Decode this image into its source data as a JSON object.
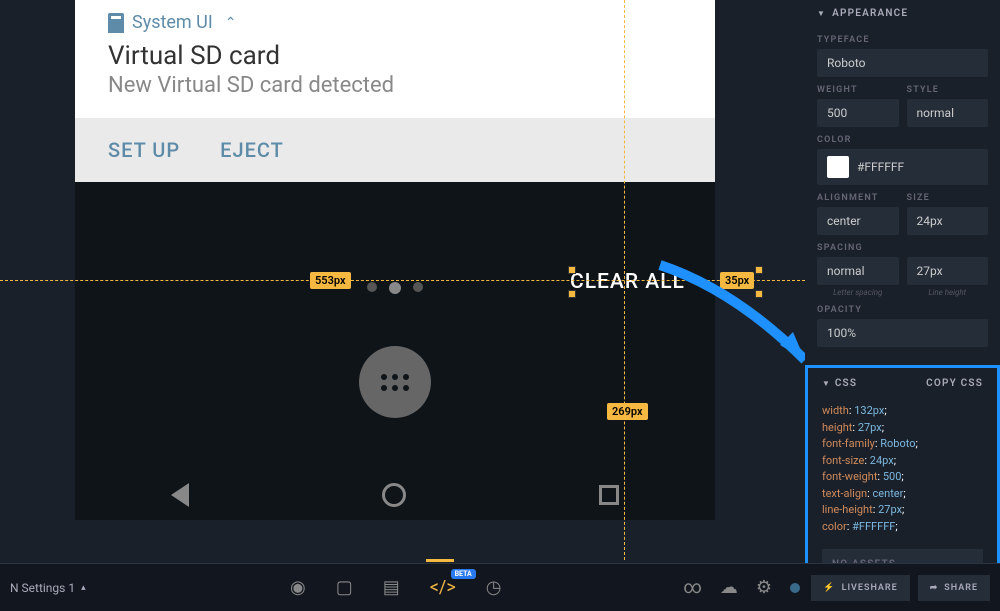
{
  "notification": {
    "app_name": "System UI",
    "title": "Virtual SD card",
    "subtitle": "New Virtual SD card detected",
    "action_setup": "SET UP",
    "action_eject": "EJECT"
  },
  "selected_element": {
    "text": "CLEAR ALL"
  },
  "measurements": {
    "left_distance": "553px",
    "right_distance": "35px",
    "bottom_distance": "269px"
  },
  "appearance": {
    "panel_title": "APPEARANCE",
    "typeface_label": "TYPEFACE",
    "typeface_value": "Roboto",
    "weight_label": "WEIGHT",
    "weight_value": "500",
    "style_label": "STYLE",
    "style_value": "normal",
    "color_label": "COLOR",
    "color_value": "#FFFFFF",
    "alignment_label": "ALIGNMENT",
    "alignment_value": "center",
    "size_label": "SIZE",
    "size_value": "24px",
    "spacing_label": "SPACING",
    "spacing_value": "normal",
    "spacing_sub": "Letter spacing",
    "lineheight_value": "27px",
    "lineheight_sub": "Line height",
    "opacity_label": "OPACITY",
    "opacity_value": "100%"
  },
  "css_panel": {
    "title": "CSS",
    "copy_label": "COPY CSS",
    "lines": [
      {
        "prop": "width",
        "val": "132px"
      },
      {
        "prop": "height",
        "val": "27px"
      },
      {
        "prop": "font-family",
        "val": "Roboto"
      },
      {
        "prop": "font-size",
        "val": "24px"
      },
      {
        "prop": "font-weight",
        "val": "500"
      },
      {
        "prop": "text-align",
        "val": "center"
      },
      {
        "prop": "line-height",
        "val": "27px"
      },
      {
        "prop": "color",
        "val": "#FFFFFF"
      }
    ],
    "no_assets": "NO ASSETS"
  },
  "bottombar": {
    "left_label": "N Settings 1",
    "beta_label": "BETA",
    "liveshare": "LIVESHARE",
    "share": "SHARE"
  }
}
